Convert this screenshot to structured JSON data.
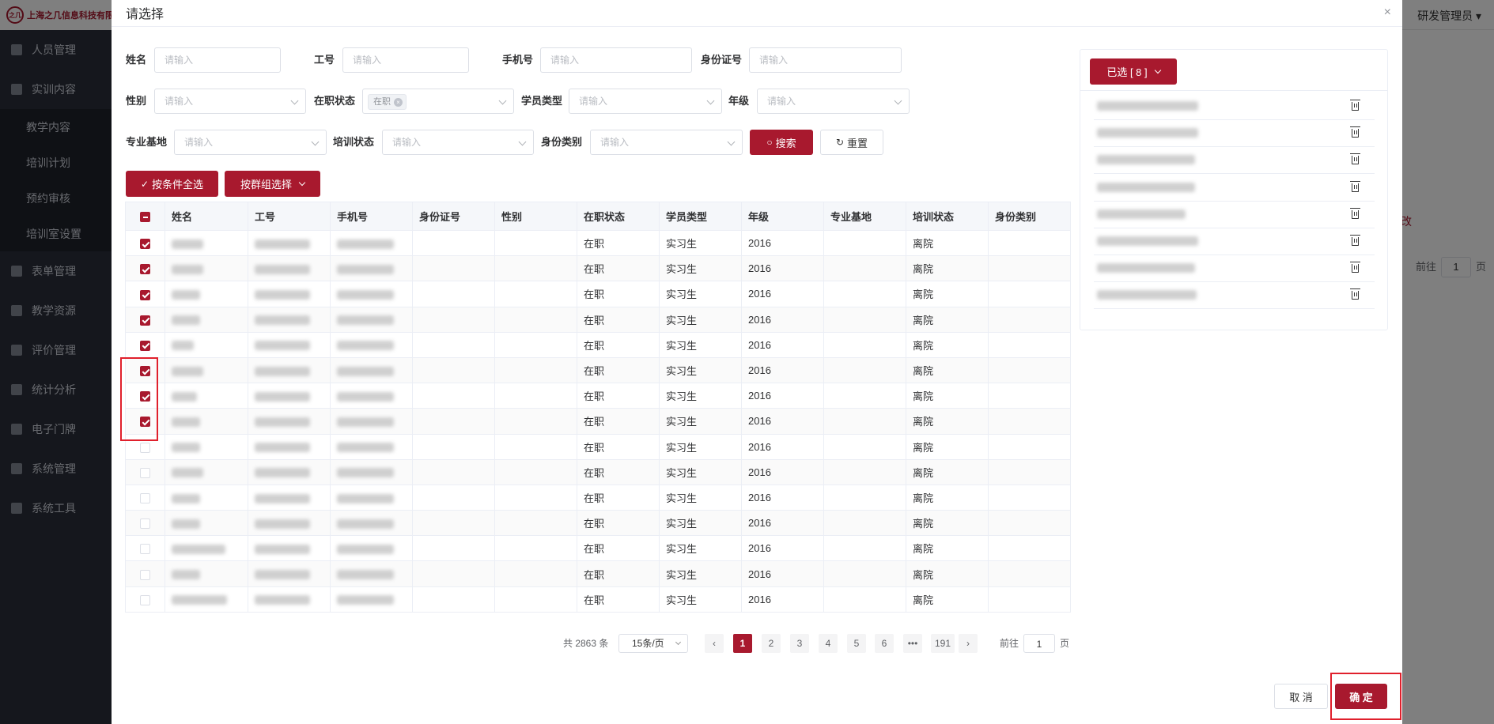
{
  "app": {
    "company": "上海之几信息科技有限",
    "logo_text": "之几",
    "user": "研发管理员",
    "sidebar": [
      {
        "label": "人员管理",
        "type": "item"
      },
      {
        "label": "实训内容",
        "type": "item"
      },
      {
        "label": "教学内容",
        "type": "sub"
      },
      {
        "label": "培训计划",
        "type": "sub"
      },
      {
        "label": "预约审核",
        "type": "sub"
      },
      {
        "label": "培训室设置",
        "type": "sub"
      },
      {
        "label": "表单管理",
        "type": "item"
      },
      {
        "label": "教学资源",
        "type": "item"
      },
      {
        "label": "评价管理",
        "type": "item"
      },
      {
        "label": "统计分析",
        "type": "item"
      },
      {
        "label": "电子门牌",
        "type": "item"
      },
      {
        "label": "系统管理",
        "type": "item"
      },
      {
        "label": "系统工具",
        "type": "item"
      }
    ],
    "bg_fragment_edit": "改",
    "bg_goto": "前往",
    "bg_goto_page": "1",
    "bg_page_unit": "页"
  },
  "dialog": {
    "title": "请选择",
    "close": "×",
    "filters": {
      "name_label": "姓名",
      "jobno_label": "工号",
      "phone_label": "手机号",
      "idcard_label": "身份证号",
      "gender_label": "性别",
      "status_label": "在职状态",
      "trainee_type_label": "学员类型",
      "grade_label": "年级",
      "base_label": "专业基地",
      "train_status_label": "培训状态",
      "identity_label": "身份类别",
      "placeholder": "请输入",
      "status_tag": "在职"
    },
    "buttons": {
      "search": "搜索",
      "reset": "重置",
      "select_all_condition": "按条件全选",
      "select_by_group": "按群组选择",
      "cancel": "取 消",
      "confirm": "确 定"
    },
    "table": {
      "columns": [
        "姓名",
        "工号",
        "手机号",
        "身份证号",
        "性别",
        "在职状态",
        "学员类型",
        "年级",
        "专业基地",
        "培训状态",
        "身份类别"
      ],
      "rows": [
        {
          "checked": true,
          "status": "在职",
          "type": "实习生",
          "grade": "2016",
          "train": "离院"
        },
        {
          "checked": true,
          "status": "在职",
          "type": "实习生",
          "grade": "2016",
          "train": "离院"
        },
        {
          "checked": true,
          "status": "在职",
          "type": "实习生",
          "grade": "2016",
          "train": "离院"
        },
        {
          "checked": true,
          "status": "在职",
          "type": "实习生",
          "grade": "2016",
          "train": "离院"
        },
        {
          "checked": true,
          "status": "在职",
          "type": "实习生",
          "grade": "2016",
          "train": "离院"
        },
        {
          "checked": true,
          "status": "在职",
          "type": "实习生",
          "grade": "2016",
          "train": "离院"
        },
        {
          "checked": true,
          "status": "在职",
          "type": "实习生",
          "grade": "2016",
          "train": "离院"
        },
        {
          "checked": true,
          "status": "在职",
          "type": "实习生",
          "grade": "2016",
          "train": "离院"
        },
        {
          "checked": false,
          "status": "在职",
          "type": "实习生",
          "grade": "2016",
          "train": "离院"
        },
        {
          "checked": false,
          "status": "在职",
          "type": "实习生",
          "grade": "2016",
          "train": "离院"
        },
        {
          "checked": false,
          "status": "在职",
          "type": "实习生",
          "grade": "2016",
          "train": "离院"
        },
        {
          "checked": false,
          "status": "在职",
          "type": "实习生",
          "grade": "2016",
          "train": "离院"
        },
        {
          "checked": false,
          "status": "在职",
          "type": "实习生",
          "grade": "2016",
          "train": "离院"
        },
        {
          "checked": false,
          "status": "在职",
          "type": "实习生",
          "grade": "2016",
          "train": "离院"
        },
        {
          "checked": false,
          "status": "在职",
          "type": "实习生",
          "grade": "2016",
          "train": "离院"
        }
      ]
    },
    "pagination": {
      "total": "共 2863 条",
      "page_size": "15条/页",
      "pages": [
        "1",
        "2",
        "3",
        "4",
        "5",
        "6",
        "•••",
        "191"
      ],
      "current": "1",
      "goto_label": "前往",
      "goto_value": "1",
      "page_unit": "页"
    },
    "selected": {
      "button": "已选 [ 8 ]",
      "count": 8
    }
  },
  "colors": {
    "primary": "#a8192e",
    "highlight": "#e0202c"
  }
}
